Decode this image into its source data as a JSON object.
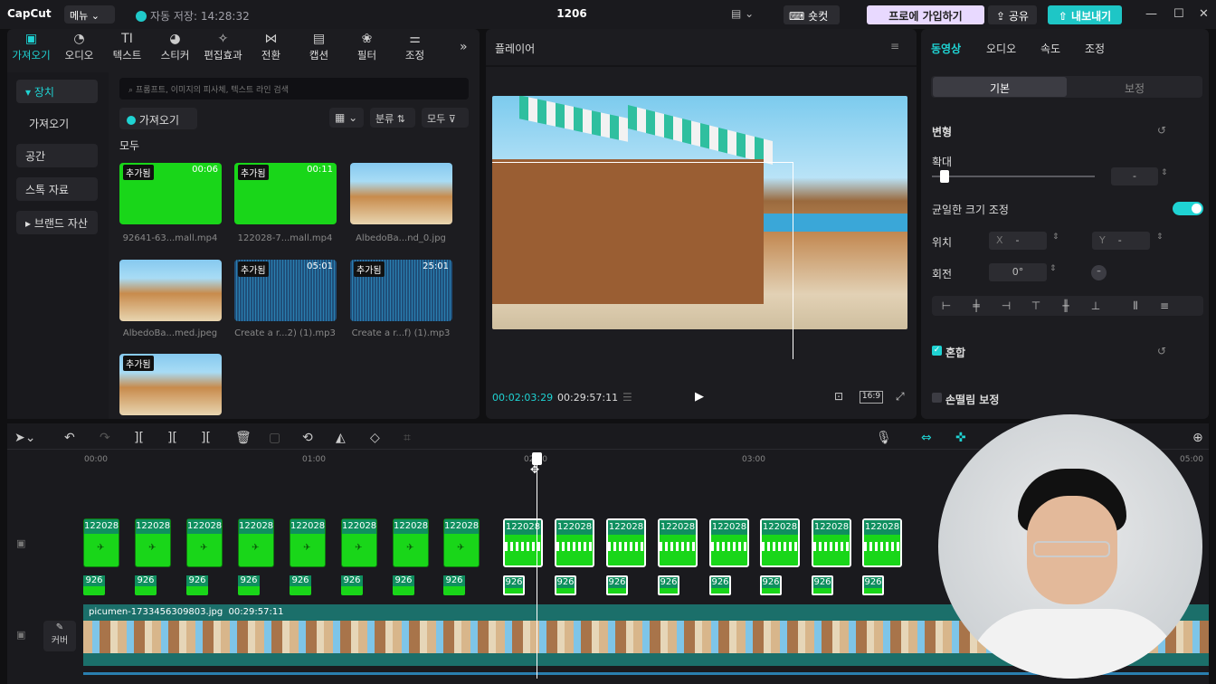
{
  "topbar": {
    "logo": "CapCut",
    "menu_label": "메뉴",
    "autosave": "자동 저장: 14:28:32",
    "project_title": "1206",
    "shortcut_label": "숏컷",
    "pro_label": "프로에 가입하기",
    "share_label": "공유",
    "export_label": "내보내기"
  },
  "media_tabs": [
    {
      "label": "가져오기",
      "icon": "import-icon"
    },
    {
      "label": "오디오",
      "icon": "audio-icon"
    },
    {
      "label": "텍스트",
      "icon": "text-icon"
    },
    {
      "label": "스티커",
      "icon": "sticker-icon"
    },
    {
      "label": "편집효과",
      "icon": "effects-icon"
    },
    {
      "label": "전환",
      "icon": "transition-icon"
    },
    {
      "label": "캡션",
      "icon": "caption-icon"
    },
    {
      "label": "필터",
      "icon": "filter-icon"
    },
    {
      "label": "조정",
      "icon": "adjust-icon"
    }
  ],
  "left_nav": [
    "장치",
    "가져오기",
    "공간",
    "스톡 자료",
    "브랜드 자산"
  ],
  "search_placeholder": "프롬프트, 이미지의 피사체, 텍스트 라인 검색",
  "import_button": "가져오기",
  "sort_label": "분류",
  "all_filter": "모두",
  "section_all": "모두",
  "media_items": [
    {
      "name": "92641-63...mall.mp4",
      "tag": "추가됨",
      "duration": "00:06",
      "kind": "green"
    },
    {
      "name": "122028-7...mall.mp4",
      "tag": "추가됨",
      "duration": "00:11",
      "kind": "green"
    },
    {
      "name": "AlbedoBa...nd_0.jpg",
      "tag": "",
      "duration": "",
      "kind": "photo"
    },
    {
      "name": "AlbedoBa...med.jpeg",
      "tag": "",
      "duration": "",
      "kind": "photo"
    },
    {
      "name": "Create a r...2) (1).mp3",
      "tag": "추가됨",
      "duration": "05:01",
      "kind": "audio"
    },
    {
      "name": "Create a r...f) (1).mp3",
      "tag": "추가됨",
      "duration": "25:01",
      "kind": "audio"
    },
    {
      "name": "",
      "tag": "추가됨",
      "duration": "",
      "kind": "photo"
    }
  ],
  "player": {
    "title": "플레이어",
    "current_time": "00:02:03:29",
    "total_time": "00:29:57:11",
    "ratio": "16:9"
  },
  "inspector": {
    "tabs": [
      "동영상",
      "오디오",
      "속도",
      "조정"
    ],
    "subtabs": [
      "기본",
      "보정"
    ],
    "transform_label": "변형",
    "scale_label": "확대",
    "scale_value": "-",
    "scale_level": 0.08,
    "uniform_label": "균일한 크기 조정",
    "position_label": "위치",
    "x_label": "X",
    "x_value": "-",
    "y_label": "Y",
    "y_value": "-",
    "rotation_label": "회전",
    "rotation_value": "0°",
    "blend_label": "혼합",
    "stabilize_label": "손떨림 보정"
  },
  "timeline": {
    "ticks": [
      "00:00",
      "01:00",
      "02:00",
      "03:00",
      "05:00"
    ],
    "video_clip_label": "122028",
    "audio_clip_label": "926",
    "main_clip_name": "picumen-1733456309803.jpg",
    "main_clip_duration": "00:29:57:11",
    "cover_label": "커버"
  },
  "colors": {
    "accent": "#1fd3d3",
    "green_screen": "#19d619",
    "main_track": "#1b6f6a"
  }
}
